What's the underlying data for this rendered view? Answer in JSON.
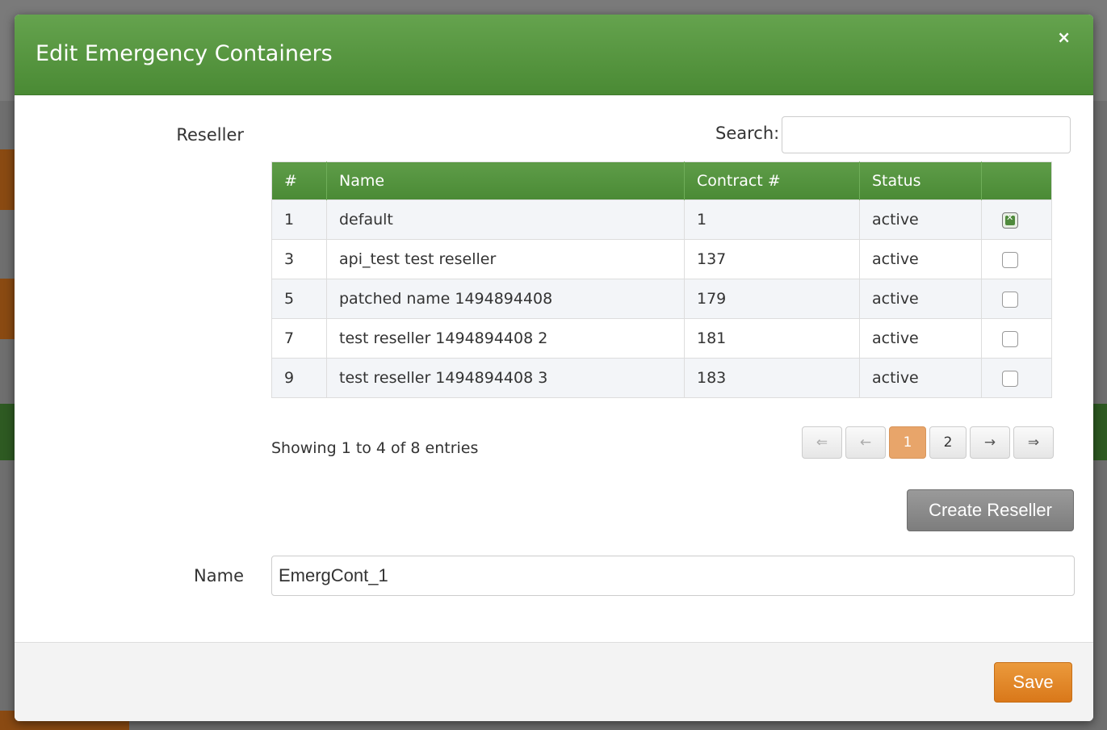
{
  "modal": {
    "title": "Edit Emergency Containers",
    "close_symbol": "×"
  },
  "reseller": {
    "label": "Reseller",
    "search_label": "Search:",
    "search_value": "",
    "columns": [
      "#",
      "Name",
      "Contract #",
      "Status",
      ""
    ],
    "rows": [
      {
        "id": "1",
        "name": "default",
        "contract": "1",
        "status": "active",
        "selected": true
      },
      {
        "id": "3",
        "name": "api_test test reseller",
        "contract": "137",
        "status": "active",
        "selected": false
      },
      {
        "id": "5",
        "name": "patched name 1494894408",
        "contract": "179",
        "status": "active",
        "selected": false
      },
      {
        "id": "7",
        "name": "test reseller 1494894408 2",
        "contract": "181",
        "status": "active",
        "selected": false
      },
      {
        "id": "9",
        "name": "test reseller 1494894408 3",
        "contract": "183",
        "status": "active",
        "selected": false
      }
    ],
    "info": "Showing 1 to 4 of 8 entries",
    "pager": {
      "first": "⇐",
      "prev": "←",
      "pages": [
        "1",
        "2"
      ],
      "current": "1",
      "next": "→",
      "last": "⇒"
    },
    "create_button": "Create Reseller"
  },
  "name_field": {
    "label": "Name",
    "value": "EmergCont_1"
  },
  "footer": {
    "save_button": "Save"
  },
  "colors": {
    "header_green": "#5a9a44",
    "save_orange": "#e08a2a",
    "active_page": "#e8a56a",
    "create_gray": "#8a8a8a"
  }
}
